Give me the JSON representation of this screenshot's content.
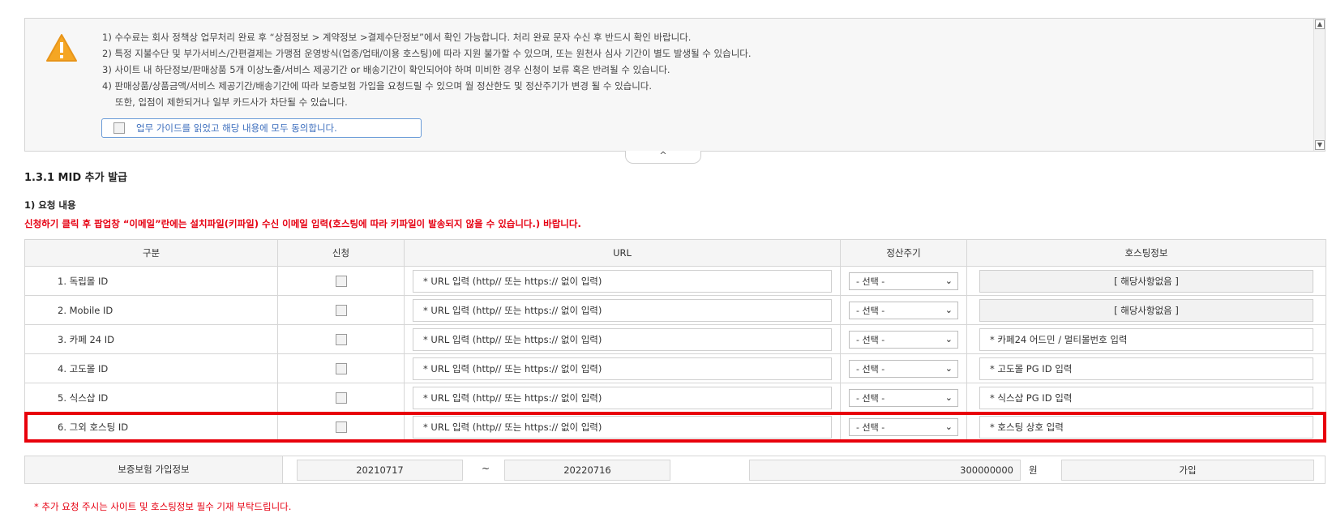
{
  "notice": {
    "lines": [
      "1) 수수료는 회사 정책상 업무처리 완료 후 “상점정보 > 계약정보 >결제수단정보”에서 확인 가능합니다. 처리 완료 문자 수신 후 반드시 확인 바랍니다.",
      "2) 특정 지불수단 및 부가서비스/간편결제는 가맹점 운영방식(업종/업태/이용 호스팅)에 따라 지원 불가할 수 있으며, 또는 원천사 심사 기간이 별도 발생될 수 있습니다.",
      "3) 사이트 내 하단정보/판매상품 5개 이상노출/서비스 제공기간 or 배송기간이 확인되어야 하며 미비한 경우 신청이 보류 혹은 반려될 수 있습니다.",
      "4) 판매상품/상품금액/서비스 제공기간/배송기간에 따라 보증보험 가입을 요청드릴 수 있으며 월 정산한도 및 정산주기가 변경 될 수 있습니다.",
      "또한, 입점이 제한되거나 일부 카드사가 차단될 수 있습니다."
    ],
    "agree_label": "업무 가이드를 읽었고 해당 내용에 모두 동의합니다.",
    "warning_icon": "warning-triangle-icon",
    "collapse_icon": "chevron-up-icon"
  },
  "section_title": "1.3.1 MID 추가 발급",
  "request_title": "1) 요청 내용",
  "request_note": "신청하기 클릭 후 팝업창 “이메일”란에는 설치파일(키파일) 수신 이메일 입력(호스팅에 따라 키파일이 발송되지 않을 수 있습니다.) 바랍니다.",
  "table": {
    "headers": [
      "구분",
      "신청",
      "URL",
      "정산주기",
      "호스팅정보"
    ],
    "rows": [
      {
        "name": "1. 독립몰 ID",
        "url_placeholder": "* URL 입력 (http// 또는 https:// 없이 입력)",
        "cycle": "- 선택 -",
        "hosting": "[ 해당사항없음 ]"
      },
      {
        "name": "2. Mobile ID",
        "url_placeholder": "* URL 입력 (http// 또는 https:// 없이 입력)",
        "cycle": "- 선택 -",
        "hosting": "[ 해당사항없음 ]"
      },
      {
        "name": "3. 카페 24 ID",
        "url_placeholder": "* URL 입력 (http// 또는 https:// 없이 입력)",
        "cycle": "- 선택 -",
        "hosting": "* 카페24 어드민 / 멀티몰번호 입력"
      },
      {
        "name": "4. 고도몰 ID",
        "url_placeholder": "* URL 입력 (http// 또는 https:// 없이 입력)",
        "cycle": "- 선택 -",
        "hosting": "* 고도몰 PG ID 입력"
      },
      {
        "name": "5. 식스샵 ID",
        "url_placeholder": "* URL 입력 (http// 또는 https:// 없이 입력)",
        "cycle": "- 선택 -",
        "hosting": "* 식스샵 PG ID 입력"
      },
      {
        "name": "6. 그외 호스팅 ID",
        "url_placeholder": "* URL 입력 (http// 또는 https:// 없이 입력)",
        "cycle": "- 선택 -",
        "hosting": "* 호스팅 상호 입력"
      }
    ]
  },
  "insurance": {
    "label": "보증보험 가입정보",
    "start_date": "20210717",
    "tilde": "~",
    "end_date": "20220716",
    "amount": "300000000",
    "unit": "원",
    "status": "가입"
  },
  "footer_note": "* 추가 요청 주시는 사이트 및 호스팅정보 필수 기재 부탁드립니다.",
  "colors": {
    "highlight": "#e8000b",
    "note_red": "#e60012",
    "warning": "#f5a623",
    "agree_border": "#6a9bd8"
  }
}
